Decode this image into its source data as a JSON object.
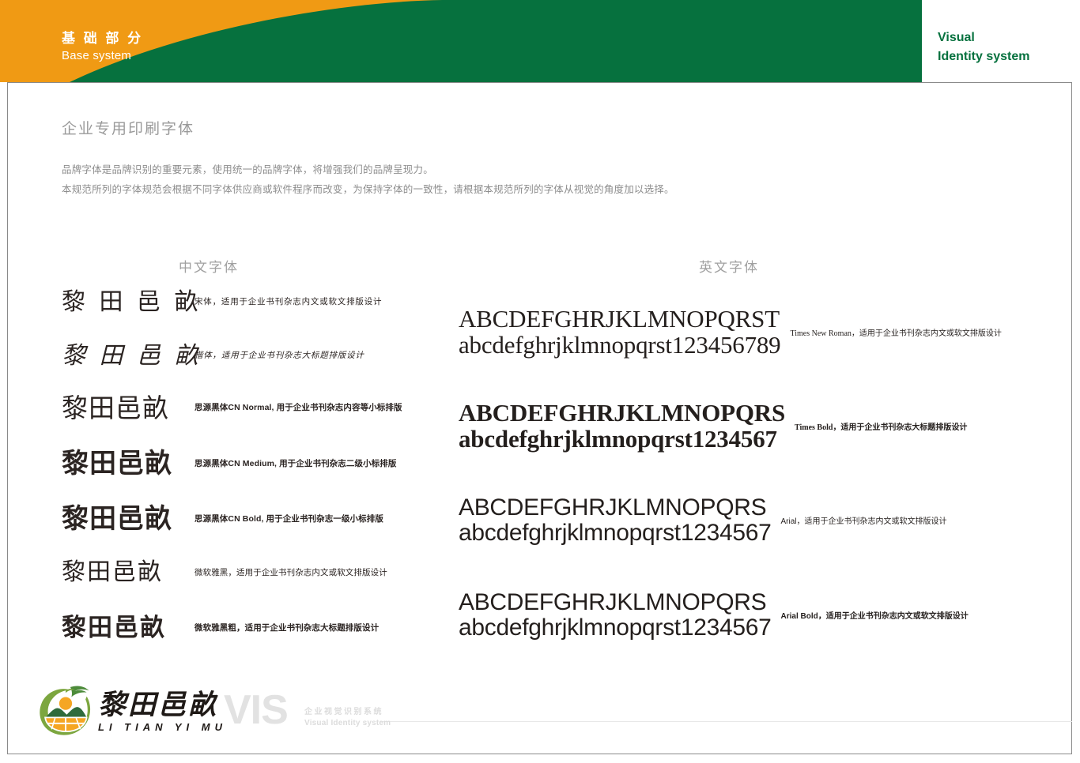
{
  "colors": {
    "orange": "#F09A14",
    "green": "#06713E",
    "heading_gray": "#9A9A9A",
    "body_gray": "#8D8D8D",
    "ink": "#2B2422",
    "watermark_gray": "#E2E2E2",
    "logo_leaf_green": "#6E9A3C",
    "logo_hill_green": "#2F6B3C",
    "logo_sun_orange": "#F5A623"
  },
  "header": {
    "title_zh": "基 础 部 分",
    "title_en": "Base system",
    "right_line1": "Visual",
    "right_line2": "Identity system"
  },
  "section": {
    "title": "企业专用印刷字体",
    "intro_line1": "品牌字体是品牌识别的重要元素，使用统一的品牌字体，将增强我们的品牌呈现力。",
    "intro_line2": "本规范所列的字体规范会根据不同字体供应商或软件程序而改变，为保持字体的一致性，请根据本规范所列的字体从视觉的角度加以选择。"
  },
  "columns": {
    "chinese_heading": "中文字体",
    "english_heading": "英文字体"
  },
  "chinese_fonts": [
    {
      "sample": "黎 田 邑 畝",
      "desc": "宋体，适用于企业书刊杂志内文或软文排版设计",
      "style": "song"
    },
    {
      "sample": "黎 田 邑 畝",
      "desc": "楷体，适用于企业书刊杂志大标题排版设计",
      "style": "kai"
    },
    {
      "sample": "黎田邑畝",
      "desc": "思源黑体CN Normal, 用于企业书刊杂志内容等小标排版",
      "style": "normal"
    },
    {
      "sample": "黎田邑畝",
      "desc": "思源黑体CN Medium, 用于企业书刊杂志二级小标排版",
      "style": "medium"
    },
    {
      "sample": "黎田邑畝",
      "desc": "思源黑体CN Bold, 用于企业书刊杂志一级小标排版",
      "style": "bold"
    },
    {
      "sample": "黎田邑畝",
      "desc": "微软雅黑，适用于企业书刊杂志内文或软文排版设计",
      "style": "yahei"
    },
    {
      "sample": "黎田邑畝",
      "desc": "微软雅黑粗，适用于企业书刊杂志大标题排版设计",
      "style": "yaheib"
    }
  ],
  "english_fonts": [
    {
      "upper": "ABCDEFGHRJKLMNOPQRST",
      "lower": "abcdefghrjklmnopqrst123456789",
      "desc": "Times New Roman，适用于企业书刊杂志内文或软文排版设计",
      "style": "times"
    },
    {
      "upper": "ABCDEFGHRJKLMNOPQRS",
      "lower": "abcdefghrjklmnopqrst1234567",
      "desc": "Times Bold，适用于企业书刊杂志大标题排版设计",
      "style": "timesb"
    },
    {
      "upper": "ABCDEFGHRJKLMNOPQRS",
      "lower": "abcdefghrjklmnopqrst1234567",
      "desc": "Arial，适用于企业书刊杂志内文或软文排版设计",
      "style": "arial"
    },
    {
      "upper": "ABCDEFGHRJKLMNOPQRS",
      "lower": "abcdefghrjklmnopqrst1234567",
      "desc": "Arial Bold，适用于企业书刊杂志内文或软文排版设计",
      "style": "arialb"
    }
  ],
  "footer": {
    "logo_zh": "黎田邑畝",
    "logo_en": "LI TIAN YI MU",
    "watermark": "VIS",
    "watermark_sub_zh": "企业视觉识别系统",
    "watermark_sub_en": "Visual Identity system"
  }
}
